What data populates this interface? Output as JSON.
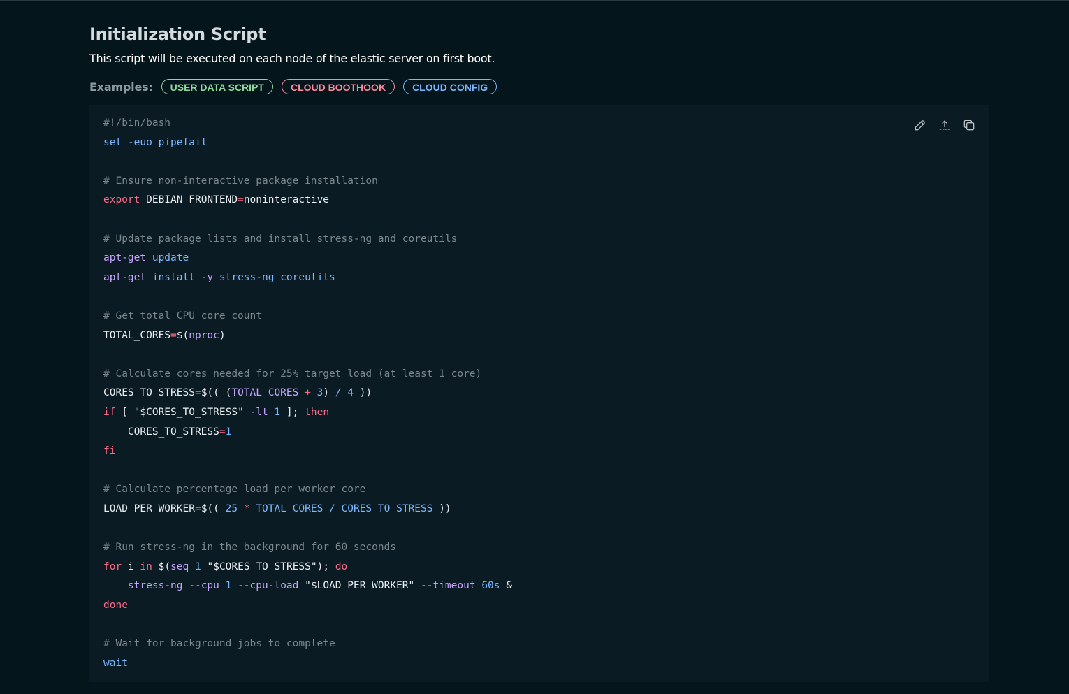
{
  "header": {
    "title": "Initialization Script",
    "subtitle": "This script will be executed on each node of the elastic server on first boot."
  },
  "examples": {
    "label": "Examples:",
    "chips": [
      {
        "label": "USER DATA SCRIPT",
        "color": "#8fd99a"
      },
      {
        "label": "CLOUD BOOTHOOK",
        "color": "#ff8a9b"
      },
      {
        "label": "CLOUD CONFIG",
        "color": "#7cb8ff"
      }
    ]
  },
  "toolbar": {
    "icons": [
      "edit-icon",
      "upload-icon",
      "copy-icon"
    ]
  },
  "code": {
    "language": "bash",
    "lines": [
      [
        [
          "comment",
          "#!/bin/bash"
        ]
      ],
      [
        [
          "builtin",
          "set"
        ],
        [
          "var",
          " "
        ],
        [
          "builtin",
          "-euo"
        ],
        [
          "var",
          " "
        ],
        [
          "builtin",
          "pipefail"
        ]
      ],
      [],
      [
        [
          "comment",
          "# Ensure non-interactive package installation"
        ]
      ],
      [
        [
          "keyword",
          "export"
        ],
        [
          "var",
          " DEBIAN_FRONTEND"
        ],
        [
          "op",
          "="
        ],
        [
          "var",
          "noninteractive"
        ]
      ],
      [],
      [
        [
          "comment",
          "# Update package lists and install stress-ng and coreutils"
        ]
      ],
      [
        [
          "cmd",
          "apt-get"
        ],
        [
          "var",
          " "
        ],
        [
          "builtin",
          "update"
        ]
      ],
      [
        [
          "cmd",
          "apt-get"
        ],
        [
          "var",
          " "
        ],
        [
          "builtin",
          "install"
        ],
        [
          "var",
          " "
        ],
        [
          "flag",
          "-y"
        ],
        [
          "var",
          " "
        ],
        [
          "builtin",
          "stress-ng"
        ],
        [
          "var",
          " "
        ],
        [
          "builtin",
          "coreutils"
        ]
      ],
      [],
      [
        [
          "comment",
          "# Get total CPU core count"
        ]
      ],
      [
        [
          "var",
          "TOTAL_CORES"
        ],
        [
          "op",
          "="
        ],
        [
          "var",
          "$("
        ],
        [
          "cmd",
          "nproc"
        ],
        [
          "var",
          ")"
        ]
      ],
      [],
      [
        [
          "comment",
          "# Calculate cores needed for 25% target load (at least 1 core)"
        ]
      ],
      [
        [
          "var",
          "CORES_TO_STRESS"
        ],
        [
          "op",
          "="
        ],
        [
          "var",
          "$(( ("
        ],
        [
          "cmd",
          "TOTAL_CORES"
        ],
        [
          "var",
          " "
        ],
        [
          "op",
          "+"
        ],
        [
          "var",
          " "
        ],
        [
          "num",
          "3"
        ],
        [
          "var",
          ") "
        ],
        [
          "builtin",
          "/"
        ],
        [
          "var",
          " "
        ],
        [
          "num",
          "4"
        ],
        [
          "var",
          " ))"
        ]
      ],
      [
        [
          "keyword",
          "if"
        ],
        [
          "var",
          " [ \"$CORES_TO_STRESS\" "
        ],
        [
          "flag",
          "-lt"
        ],
        [
          "var",
          " "
        ],
        [
          "num",
          "1"
        ],
        [
          "var",
          " ]; "
        ],
        [
          "keyword",
          "then"
        ]
      ],
      [
        [
          "var",
          "    CORES_TO_STRESS"
        ],
        [
          "op",
          "="
        ],
        [
          "num",
          "1"
        ]
      ],
      [
        [
          "keyword",
          "fi"
        ]
      ],
      [],
      [
        [
          "comment",
          "# Calculate percentage load per worker core"
        ]
      ],
      [
        [
          "var",
          "LOAD_PER_WORKER"
        ],
        [
          "op",
          "="
        ],
        [
          "var",
          "$(( "
        ],
        [
          "num",
          "25"
        ],
        [
          "var",
          " "
        ],
        [
          "op",
          "*"
        ],
        [
          "var",
          " "
        ],
        [
          "builtin",
          "TOTAL_CORES"
        ],
        [
          "var",
          " "
        ],
        [
          "builtin",
          "/"
        ],
        [
          "var",
          " "
        ],
        [
          "builtin",
          "CORES_TO_STRESS"
        ],
        [
          "var",
          " ))"
        ]
      ],
      [],
      [
        [
          "comment",
          "# Run stress-ng in the background for 60 seconds"
        ]
      ],
      [
        [
          "keyword",
          "for"
        ],
        [
          "var",
          " i "
        ],
        [
          "keyword",
          "in"
        ],
        [
          "var",
          " $("
        ],
        [
          "cmd",
          "seq"
        ],
        [
          "var",
          " "
        ],
        [
          "num",
          "1"
        ],
        [
          "var",
          " \"$CORES_TO_STRESS\"); "
        ],
        [
          "keyword",
          "do"
        ]
      ],
      [
        [
          "var",
          "    "
        ],
        [
          "cmd",
          "stress-ng"
        ],
        [
          "var",
          " "
        ],
        [
          "flag",
          "--cpu"
        ],
        [
          "var",
          " "
        ],
        [
          "num",
          "1"
        ],
        [
          "var",
          " "
        ],
        [
          "flag",
          "--cpu-load"
        ],
        [
          "var",
          " \"$LOAD_PER_WORKER\" "
        ],
        [
          "flag",
          "--timeout"
        ],
        [
          "var",
          " "
        ],
        [
          "builtin",
          "60s"
        ],
        [
          "var",
          " &"
        ]
      ],
      [
        [
          "keyword",
          "done"
        ]
      ],
      [],
      [
        [
          "comment",
          "# Wait for background jobs to complete"
        ]
      ],
      [
        [
          "builtin",
          "wait"
        ]
      ]
    ]
  }
}
